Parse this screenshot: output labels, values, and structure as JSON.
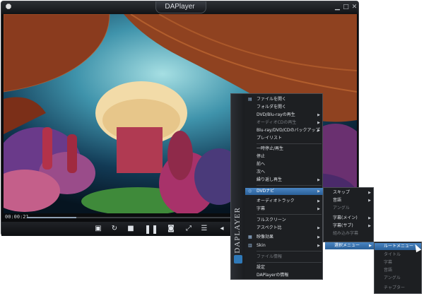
{
  "window": {
    "title": "DAPlayer",
    "app_icon": "player-icon",
    "controls": [
      "minimize-icon",
      "maximize-icon",
      "close-icon"
    ]
  },
  "playback": {
    "time": "00:00:21",
    "progress": 0.24
  },
  "control_bar": [
    {
      "name": "screenshot-icon",
      "glyph": "▣"
    },
    {
      "name": "repeat-icon",
      "glyph": "↻"
    },
    {
      "name": "stop-icon",
      "glyph": "■"
    },
    {
      "name": "pause-icon",
      "glyph": "❚❚"
    },
    {
      "name": "camera-icon",
      "glyph": "◙"
    },
    {
      "name": "fullscreen-icon",
      "glyph": "⤢"
    },
    {
      "name": "playlist-icon",
      "glyph": "☰"
    },
    {
      "name": "volume-icon",
      "glyph": "◂"
    }
  ],
  "context_menu": {
    "brand": "DAPLAYER",
    "items": [
      {
        "label": "ファイルを開く",
        "icon": "folder-icon",
        "dim": false,
        "arrow": false
      },
      {
        "label": "フォルダを開く",
        "dim": false,
        "arrow": false
      },
      {
        "label": "DVD/Blu-rayの再生",
        "dim": false,
        "arrow": true
      },
      {
        "label": "オーディオCDの再生",
        "dim": true,
        "arrow": true
      },
      {
        "label": "Blu-ray/DVD/CDのバックアップ",
        "dim": false,
        "arrow": true
      },
      {
        "label": "プレイリスト",
        "dim": false,
        "arrow": false
      },
      {
        "label": "一時停止/再生",
        "dim": false,
        "arrow": false
      },
      {
        "label": "停止",
        "dim": false,
        "arrow": false
      },
      {
        "label": "前へ",
        "dim": false,
        "arrow": false
      },
      {
        "label": "次へ",
        "dim": false,
        "arrow": false
      },
      {
        "label": "繰り返し再生",
        "dim": false,
        "arrow": true
      },
      {
        "label": "DVDナビ",
        "icon": "disc-icon",
        "dim": false,
        "arrow": true,
        "highlight": true
      },
      {
        "label": "オーディオトラック",
        "dim": false,
        "arrow": true
      },
      {
        "label": "字幕",
        "dim": false,
        "arrow": true
      },
      {
        "label": "フルスクリーン",
        "dim": false,
        "arrow": false
      },
      {
        "label": "アスペクト比",
        "dim": false,
        "arrow": true
      },
      {
        "label": "映像効果",
        "icon": "effects-icon",
        "dim": false,
        "arrow": true
      },
      {
        "label": "Skin",
        "icon": "skin-icon",
        "dim": false,
        "arrow": true
      },
      {
        "label": "ファイル情報",
        "dim": true,
        "arrow": false
      },
      {
        "label": "設定",
        "dim": false,
        "arrow": false
      },
      {
        "label": "DAPlayerの情報",
        "dim": false,
        "arrow": false
      }
    ]
  },
  "dvd_nav_submenu": {
    "items": [
      {
        "label": "スキップ",
        "dim": false,
        "arrow": true
      },
      {
        "label": "音語",
        "dim": false,
        "arrow": true
      },
      {
        "label": "アングル",
        "dim": true,
        "arrow": false
      },
      {
        "label": "字幕(メイン)",
        "dim": false,
        "arrow": true
      },
      {
        "label": "字幕(サブ)",
        "dim": false,
        "arrow": true
      },
      {
        "label": "組み込み字幕",
        "dim": true,
        "arrow": false
      },
      {
        "label": "選択メニュー",
        "dim": false,
        "arrow": true,
        "highlight": true
      }
    ]
  },
  "select_menu_submenu": {
    "items": [
      {
        "label": "ルートメニュー",
        "dim": false,
        "highlight": true
      },
      {
        "label": "タイトル",
        "dim": true
      },
      {
        "label": "字幕",
        "dim": true
      },
      {
        "label": "音語",
        "dim": true
      },
      {
        "label": "アングル",
        "dim": true
      },
      {
        "label": "チャプター",
        "dim": true
      }
    ]
  },
  "colors": {
    "highlight": "#3b75b4",
    "menu_bg": "#1d1f22",
    "text": "#dfe2e6",
    "text_dim": "#777b80"
  }
}
